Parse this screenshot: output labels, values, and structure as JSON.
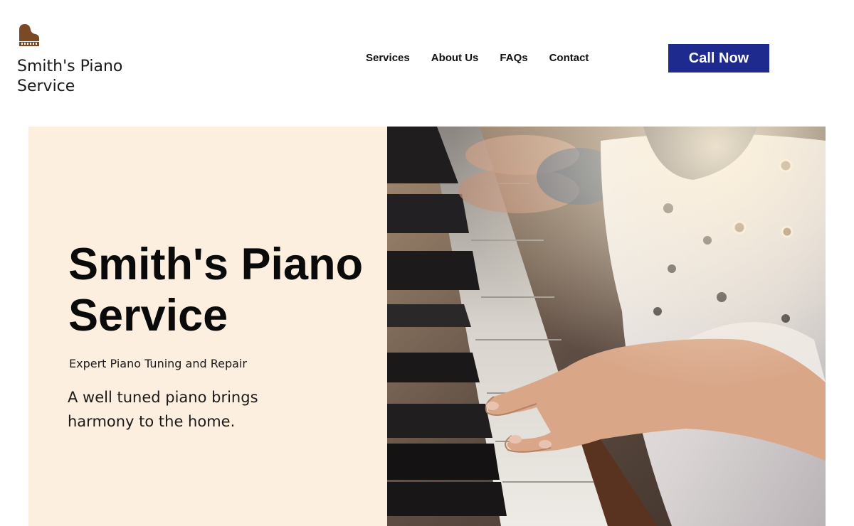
{
  "site": {
    "logo_text": "Smith's Piano Service",
    "logo_icon": "grand-piano-icon"
  },
  "nav": {
    "items": [
      {
        "label": "Services"
      },
      {
        "label": "About Us"
      },
      {
        "label": "FAQs"
      },
      {
        "label": "Contact"
      }
    ],
    "cta_label": "Call Now"
  },
  "hero": {
    "title": "Smith's Piano Service",
    "subtitle": "Expert Piano Tuning and Repair",
    "tagline": "A well tuned piano brings harmony to the home.",
    "photo": "child-playing-piano-photo"
  },
  "colors": {
    "accent": "#1f2a8f",
    "hero_background": "#fdefdf",
    "logo_icon": "#7a4a26"
  }
}
